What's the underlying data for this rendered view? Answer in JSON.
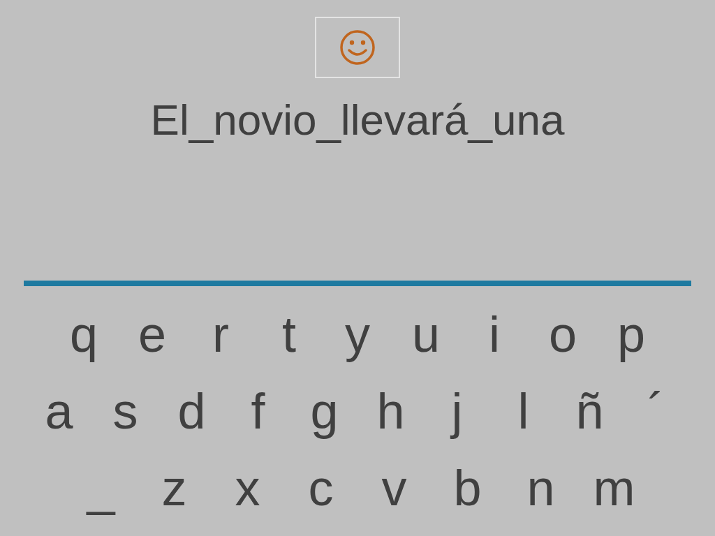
{
  "phrase": "El_novio_llevará_una",
  "keyboard": {
    "rows": [
      [
        "q",
        "e",
        "r",
        "t",
        "y",
        "u",
        "i",
        "o",
        "p"
      ],
      [
        "a",
        "s",
        "d",
        "f",
        "g",
        "h",
        "j",
        "l",
        "ñ",
        "´"
      ],
      [
        "_",
        "z",
        "x",
        "c",
        "v",
        "b",
        "n",
        "m"
      ]
    ]
  }
}
